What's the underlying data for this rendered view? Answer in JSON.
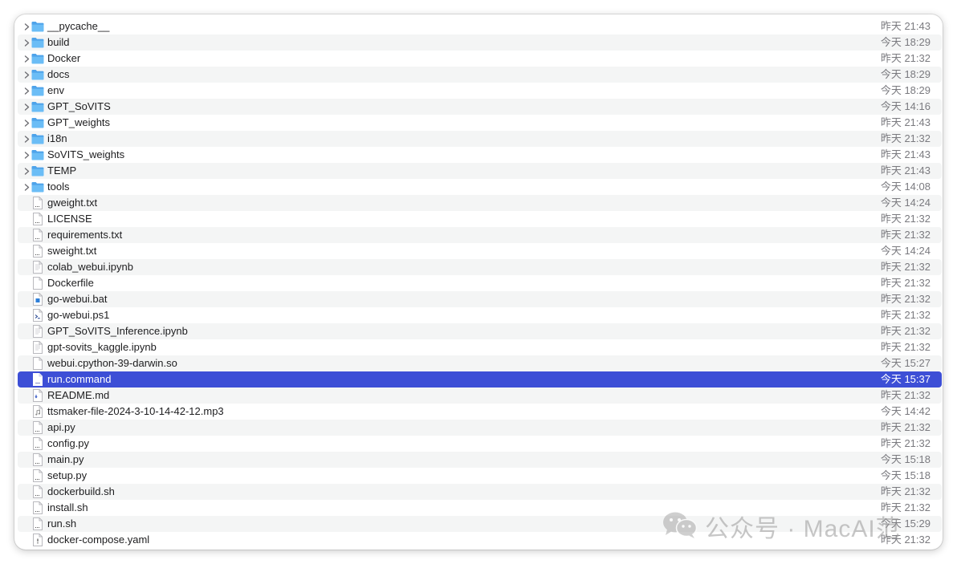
{
  "files": [
    {
      "name": "__pycache__",
      "date": "昨天 21:43",
      "kind": "folder"
    },
    {
      "name": "build",
      "date": "今天 18:29",
      "kind": "folder"
    },
    {
      "name": "Docker",
      "date": "昨天 21:32",
      "kind": "folder"
    },
    {
      "name": "docs",
      "date": "今天 18:29",
      "kind": "folder"
    },
    {
      "name": "env",
      "date": "今天 18:29",
      "kind": "folder"
    },
    {
      "name": "GPT_SoVITS",
      "date": "今天 14:16",
      "kind": "folder"
    },
    {
      "name": "GPT_weights",
      "date": "昨天 21:43",
      "kind": "folder"
    },
    {
      "name": "i18n",
      "date": "昨天 21:32",
      "kind": "folder"
    },
    {
      "name": "SoVITS_weights",
      "date": "昨天 21:43",
      "kind": "folder"
    },
    {
      "name": "TEMP",
      "date": "昨天 21:43",
      "kind": "folder"
    },
    {
      "name": "tools",
      "date": "今天 14:08",
      "kind": "folder"
    },
    {
      "name": "gweight.txt",
      "date": "今天 14:24",
      "kind": "text"
    },
    {
      "name": "LICENSE",
      "date": "昨天 21:32",
      "kind": "text"
    },
    {
      "name": "requirements.txt",
      "date": "昨天 21:32",
      "kind": "text"
    },
    {
      "name": "sweight.txt",
      "date": "今天 14:24",
      "kind": "text"
    },
    {
      "name": "colab_webui.ipynb",
      "date": "昨天 21:32",
      "kind": "notebook"
    },
    {
      "name": "Dockerfile",
      "date": "昨天 21:32",
      "kind": "blank"
    },
    {
      "name": "go-webui.bat",
      "date": "昨天 21:32",
      "kind": "bat"
    },
    {
      "name": "go-webui.ps1",
      "date": "昨天 21:32",
      "kind": "ps1"
    },
    {
      "name": "GPT_SoVITS_Inference.ipynb",
      "date": "昨天 21:32",
      "kind": "notebook"
    },
    {
      "name": "gpt-sovits_kaggle.ipynb",
      "date": "昨天 21:32",
      "kind": "notebook"
    },
    {
      "name": "webui.cpython-39-darwin.so",
      "date": "今天 15:27",
      "kind": "blank"
    },
    {
      "name": "run.command",
      "date": "今天 15:37",
      "kind": "command",
      "selected": true
    },
    {
      "name": "README.md",
      "date": "昨天 21:32",
      "kind": "markdown"
    },
    {
      "name": "ttsmaker-file-2024-3-10-14-42-12.mp3",
      "date": "今天 14:42",
      "kind": "audio"
    },
    {
      "name": "api.py",
      "date": "昨天 21:32",
      "kind": "text"
    },
    {
      "name": "config.py",
      "date": "昨天 21:32",
      "kind": "text"
    },
    {
      "name": "main.py",
      "date": "今天 15:18",
      "kind": "text"
    },
    {
      "name": "setup.py",
      "date": "今天 15:18",
      "kind": "text"
    },
    {
      "name": "dockerbuild.sh",
      "date": "昨天 21:32",
      "kind": "text"
    },
    {
      "name": "install.sh",
      "date": "昨天 21:32",
      "kind": "text"
    },
    {
      "name": "run.sh",
      "date": "今天 15:29",
      "kind": "text"
    },
    {
      "name": "docker-compose.yaml",
      "date": "昨天 21:32",
      "kind": "yaml"
    }
  ],
  "watermark": {
    "text": "公众号 · MacAI范"
  },
  "colors": {
    "folder": "#5ab0f2",
    "selection": "#3d4fd6",
    "date": "#7a7a7f"
  }
}
